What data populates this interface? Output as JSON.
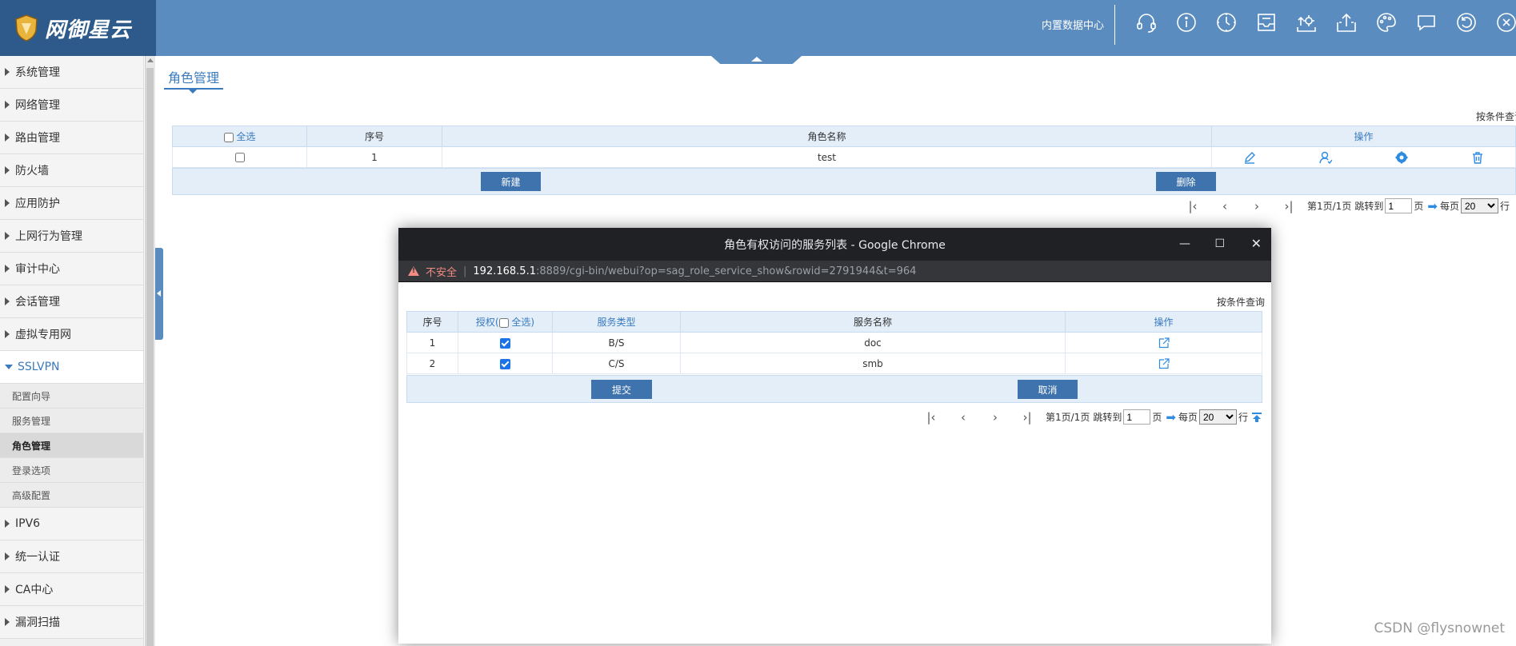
{
  "header": {
    "logo_text": "网御星云",
    "datacenter_label": "内置数据中心",
    "icons": [
      "headset-icon",
      "info-icon",
      "clock-icon",
      "inbox-icon",
      "settings-upload-icon",
      "upload-icon",
      "palette-icon",
      "chat-icon",
      "refresh-icon",
      "close-circle-icon"
    ]
  },
  "sidebar": {
    "items_top": [
      {
        "label": "系统管理"
      },
      {
        "label": "网络管理"
      },
      {
        "label": "路由管理"
      },
      {
        "label": "防火墙"
      },
      {
        "label": "应用防护"
      },
      {
        "label": "上网行为管理"
      },
      {
        "label": "审计中心"
      },
      {
        "label": "会话管理"
      },
      {
        "label": "虚拟专用网"
      }
    ],
    "open_item": {
      "label": "SSLVPN"
    },
    "sub_items": [
      {
        "label": "配置向导"
      },
      {
        "label": "服务管理"
      },
      {
        "label": "角色管理"
      },
      {
        "label": "登录选项"
      },
      {
        "label": "高级配置"
      }
    ],
    "items_bottom": [
      {
        "label": "IPV6"
      },
      {
        "label": "统一认证"
      },
      {
        "label": "CA中心"
      },
      {
        "label": "漏洞扫描"
      }
    ]
  },
  "main": {
    "title": "角色管理",
    "query_link": "按条件查询",
    "table": {
      "col_select_all": "全选",
      "col_index": "序号",
      "col_role_name": "角色名称",
      "col_actions": "操作",
      "rows": [
        {
          "index": "1",
          "role_name": "test"
        }
      ]
    },
    "buttons": {
      "new": "新建",
      "delete": "删除"
    },
    "pager": {
      "first": "⏮",
      "prev": "‹",
      "next": "›",
      "last": "⏭",
      "page_info": "第1页/1页",
      "jump_label": "跳转到",
      "jump_value": "1",
      "page_unit": "页",
      "per_page_label": "每页",
      "per_page_value": "20",
      "row_unit": "行"
    }
  },
  "popup": {
    "window_title": "角色有权访问的服务列表 - Google Chrome",
    "insecure_label": "不安全",
    "url_host": "192.168.5.1",
    "url_rest": ":8889/cgi-bin/webui?op=sag_role_service_show&rowid=2791944&t=964",
    "query_link": "按条件查询",
    "table": {
      "col_index": "序号",
      "col_authorize": "授权(",
      "col_select_all": "全选)",
      "col_service_type": "服务类型",
      "col_service_name": "服务名称",
      "col_actions": "操作",
      "rows": [
        {
          "index": "1",
          "checked": true,
          "service_type": "B/S",
          "service_name": "doc"
        },
        {
          "index": "2",
          "checked": true,
          "service_type": "C/S",
          "service_name": "smb"
        }
      ]
    },
    "buttons": {
      "submit": "提交",
      "cancel": "取消"
    },
    "pager": {
      "page_info": "第1页/1页",
      "jump_label": "跳转到",
      "jump_value": "1",
      "page_unit": "页",
      "per_page_label": "每页",
      "per_page_value": "20",
      "row_unit": "行"
    }
  },
  "watermark": "CSDN @flysnownet"
}
